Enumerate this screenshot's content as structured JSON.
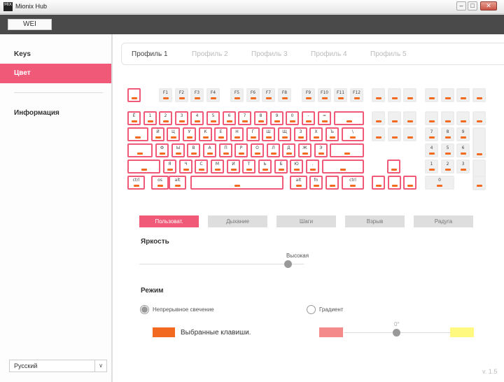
{
  "window": {
    "title": "Mionix Hub",
    "icon_text": "MIX",
    "minimize": "–",
    "maximize": "□",
    "close": "✕"
  },
  "profile_button": "WEI",
  "sidebar": {
    "items": [
      {
        "label": "Keys"
      },
      {
        "label": "Цвет",
        "active": true
      },
      {
        "label": "Информация"
      }
    ],
    "language": "Русский",
    "language_arrow": "∨"
  },
  "tabs": [
    "Профиль 1",
    "Профиль 2",
    "Профиль 3",
    "Профиль 4",
    "Профиль 5"
  ],
  "keyboard": {
    "row_fn": [
      "",
      "F1",
      "F2",
      "F3",
      "F4",
      "F5",
      "F6",
      "F7",
      "F8",
      "F9",
      "F10",
      "F11",
      "F12",
      "",
      "",
      "",
      "",
      "",
      "",
      ""
    ],
    "row_num": [
      "Ё",
      "1",
      "2",
      "3",
      "4",
      "5",
      "6",
      "7",
      "8",
      "9",
      "0",
      "-",
      "=",
      "",
      "",
      "",
      "",
      "",
      "",
      "",
      ""
    ],
    "row_q": [
      "",
      "Й",
      "Ц",
      "У",
      "К",
      "Е",
      "Н",
      "Г",
      "Ш",
      "Щ",
      "З",
      "Х",
      "Ъ",
      "\\",
      "",
      "",
      "",
      "7",
      "8",
      "9",
      ""
    ],
    "row_a": [
      "",
      "Ф",
      "Ы",
      "В",
      "А",
      "П",
      "Р",
      "О",
      "Л",
      "Д",
      "Ж",
      "Э",
      "",
      "4",
      "5",
      "6"
    ],
    "row_z": [
      "",
      "Я",
      "Ч",
      "С",
      "М",
      "И",
      "Т",
      "Ь",
      "Б",
      "Ю",
      ".",
      "",
      "",
      "1",
      "2",
      "3",
      ""
    ],
    "row_bottom": [
      "ctrl",
      "os",
      "alt",
      "",
      "alt",
      "fn",
      "",
      "ctrl",
      "",
      "",
      "",
      "0",
      ""
    ]
  },
  "effects": [
    {
      "label": "Пользоват.",
      "active": true
    },
    {
      "label": "Дыхание"
    },
    {
      "label": "Шаги"
    },
    {
      "label": "Взрыв"
    },
    {
      "label": "Радуга"
    }
  ],
  "brightness": {
    "title": "Яркость",
    "value_label": "Высокая",
    "level": 0.9
  },
  "mode": {
    "title": "Режим",
    "options": [
      {
        "label": "Непрерывное свечение",
        "selected": true
      },
      {
        "label": "Градиент",
        "selected": false
      }
    ],
    "selected_keys_label": "Выбранные клавиши.",
    "selected_color": "#f26a20",
    "gradient_start": "#f58a8a",
    "gradient_end": "#fff980",
    "gradient_angle": "0°"
  },
  "version": "v. 1.5",
  "colors": {
    "accent": "#f05a78",
    "led": "#f26a20"
  }
}
